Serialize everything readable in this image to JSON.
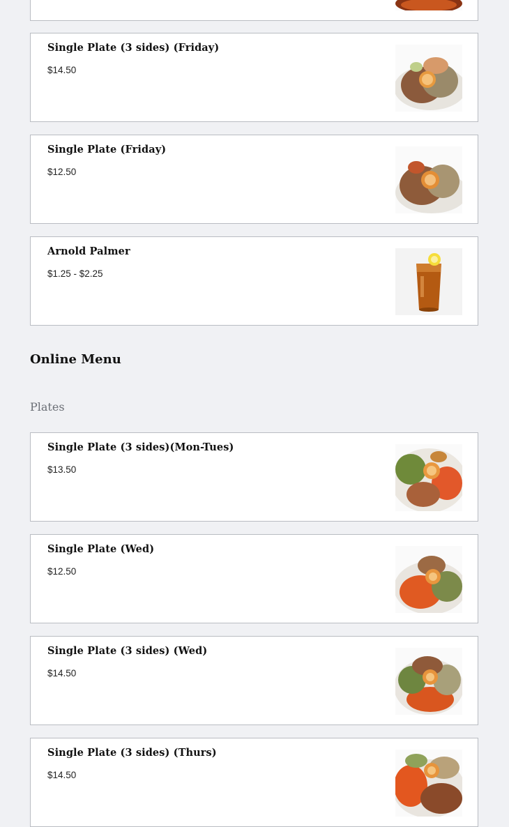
{
  "top_items": [
    {
      "name": "",
      "price": "",
      "image": "plate-food-photo"
    },
    {
      "name": "Single Plate (3 sides) (Friday)",
      "price": "$14.50",
      "image": "plate-food-photo"
    },
    {
      "name": "Single Plate (Friday)",
      "price": "$12.50",
      "image": "plate-food-photo"
    },
    {
      "name": "Arnold Palmer",
      "price": "$1.25 - $2.25",
      "image": "iced-tea-photo"
    }
  ],
  "section": {
    "title": "Online Menu"
  },
  "category": {
    "title": "Plates"
  },
  "plates": [
    {
      "name": "Single Plate (3 sides)(Mon-Tues)",
      "price": "$13.50",
      "image": "plate-food-photo"
    },
    {
      "name": "Single Plate (Wed)",
      "price": "$12.50",
      "image": "plate-food-photo"
    },
    {
      "name": "Single Plate (3 sides) (Wed)",
      "price": "$14.50",
      "image": "plate-food-photo"
    },
    {
      "name": "Single Plate (3 sides) (Thurs)",
      "price": "$14.50",
      "image": "plate-food-photo"
    }
  ],
  "colors": {
    "background": "#f0f1f4",
    "card": "#ffffff",
    "border": "#b9bcc2"
  }
}
